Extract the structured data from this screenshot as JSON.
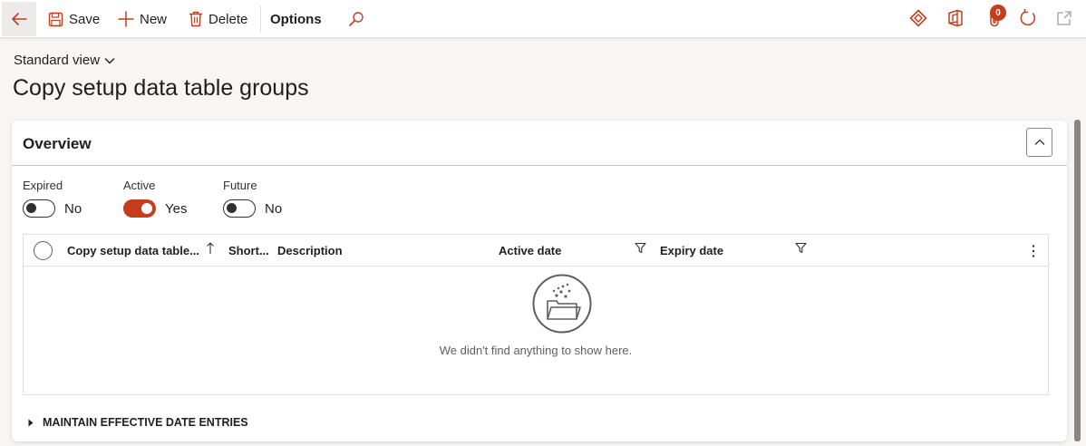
{
  "toolbar": {
    "save_label": "Save",
    "new_label": "New",
    "delete_label": "Delete",
    "options_label": "Options",
    "notification_count": "0"
  },
  "header": {
    "view_name": "Standard view",
    "title": "Copy setup data table groups"
  },
  "overview": {
    "title": "Overview",
    "filters": [
      {
        "label": "Expired",
        "value": "No",
        "on": false
      },
      {
        "label": "Active",
        "value": "Yes",
        "on": true
      },
      {
        "label": "Future",
        "value": "No",
        "on": false
      }
    ]
  },
  "grid": {
    "columns": [
      "Copy setup data table...",
      "Short...",
      "Description",
      "Active date",
      "Expiry date"
    ],
    "rows": [],
    "empty_message": "We didn't find anything to show here."
  },
  "section": {
    "maintain_label": "MAINTAIN EFFECTIVE DATE ENTRIES"
  },
  "colors": {
    "accent": "#c43e1c",
    "toggle_on": "#c43e1c"
  }
}
